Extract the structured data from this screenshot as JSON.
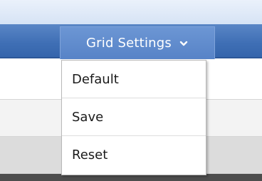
{
  "toolbar": {
    "grid_settings_label": "Grid Settings",
    "chevron_icon": "chevron-down-icon"
  },
  "menu": {
    "items": [
      {
        "label": "Default"
      },
      {
        "label": "Save"
      },
      {
        "label": "Reset"
      }
    ]
  },
  "colors": {
    "header_blue": "#3f6fb5",
    "button_blue": "#5783c7",
    "menu_bg": "#ffffff",
    "menu_text": "#1a1a1a"
  }
}
